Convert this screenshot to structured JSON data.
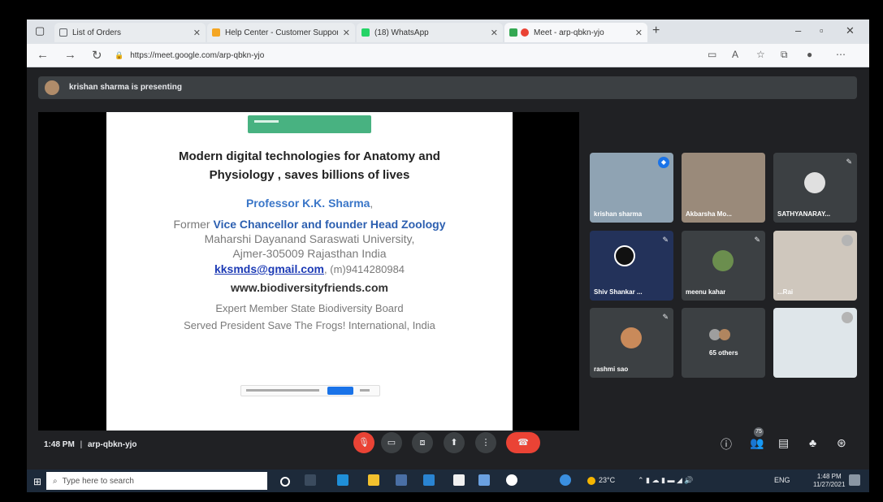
{
  "browser": {
    "tabs": [
      {
        "title": "List of Orders",
        "favicon_color": "#5f6368",
        "active": false
      },
      {
        "title": "Help Center - Customer Support",
        "favicon_color": "#f4a623",
        "active": false
      },
      {
        "title": "(18) WhatsApp",
        "favicon_color": "#25d366",
        "active": false
      },
      {
        "title": "Meet - arp-qbkn-yjo",
        "favicon_color": "#ea4335",
        "active": true
      }
    ],
    "new_tab": "+",
    "url": "https://meet.google.com/arp-qbkn-yjo"
  },
  "presenting": {
    "text": "krishan sharma is presenting"
  },
  "slide": {
    "title_line1": "Modern digital technologies for Anatomy and",
    "title_line2": "Physiology , saves billions of lives",
    "presenter": "Professor K.K. Sharma",
    "presenter_suffix": ",",
    "role_prefix": "Former ",
    "role": "Vice Chancellor and founder Head Zoology",
    "university": "Maharshi Dayanand Saraswati University,",
    "address": "Ajmer-305009 Rajasthan India",
    "email": "kksmds@gmail.com",
    "phone": ", (m)9414280984",
    "website": "www.biodiversityfriends.com",
    "line_member": "Expert Member State Biodiversity Board",
    "line_president": "Served President Save The Frogs! International, India"
  },
  "participants": [
    {
      "name": "krishan sharma"
    },
    {
      "name": "Akbarsha Mo..."
    },
    {
      "name": "SATHYANARAY..."
    },
    {
      "name": "Shiv Shankar ..."
    },
    {
      "name": "meenu kahar"
    },
    {
      "name": "...Rai"
    },
    {
      "name": "rashmi sao"
    },
    {
      "name": "65 others"
    },
    {
      "name": ""
    }
  ],
  "meeting": {
    "time": "1:48 PM",
    "separator": "|",
    "code": "arp-qbkn-yjo",
    "people_count": "75"
  },
  "taskbar": {
    "search_placeholder": "Type here to search",
    "weather": "23°C",
    "lang": "ENG",
    "clock_time": "1:48 PM",
    "clock_date": "11/27/2021"
  }
}
